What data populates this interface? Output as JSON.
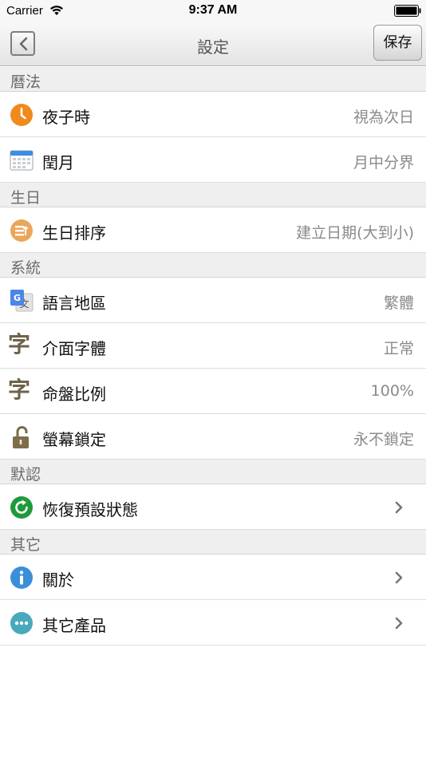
{
  "status_bar": {
    "carrier": "Carrier",
    "time": "9:37 AM"
  },
  "nav": {
    "title": "設定",
    "save_label": "保存"
  },
  "sections": {
    "calendar": {
      "header": "曆法",
      "rows": [
        {
          "label": "夜子時",
          "value": "視為次日",
          "icon": "clock-icon"
        },
        {
          "label": "閏月",
          "value": "月中分界",
          "icon": "calendar-icon"
        }
      ]
    },
    "birthday": {
      "header": "生日",
      "rows": [
        {
          "label": "生日排序",
          "value": "建立日期(大到小)",
          "icon": "sort-icon"
        }
      ]
    },
    "system": {
      "header": "系統",
      "rows": [
        {
          "label": "語言地區",
          "value": "繁體",
          "icon": "translate-icon"
        },
        {
          "label": "介面字體",
          "value": "正常",
          "icon": "font-icon",
          "glyph": "字"
        },
        {
          "label": "命盤比例",
          "value": "100%",
          "icon": "font-icon",
          "glyph": "字"
        },
        {
          "label": "螢幕鎖定",
          "value": "永不鎖定",
          "icon": "lock-icon"
        }
      ]
    },
    "defaults": {
      "header": "默認",
      "rows": [
        {
          "label": "恢復預設狀態",
          "icon": "reset-icon"
        }
      ]
    },
    "other": {
      "header": "其它",
      "rows": [
        {
          "label": "關於",
          "icon": "info-icon"
        },
        {
          "label": "其它產品",
          "icon": "more-icon"
        }
      ]
    }
  },
  "colors": {
    "accent_orange": "#f08a1c",
    "green": "#1e9a3a",
    "info_blue": "#3a8fd8",
    "teal": "#4aa8bd"
  }
}
